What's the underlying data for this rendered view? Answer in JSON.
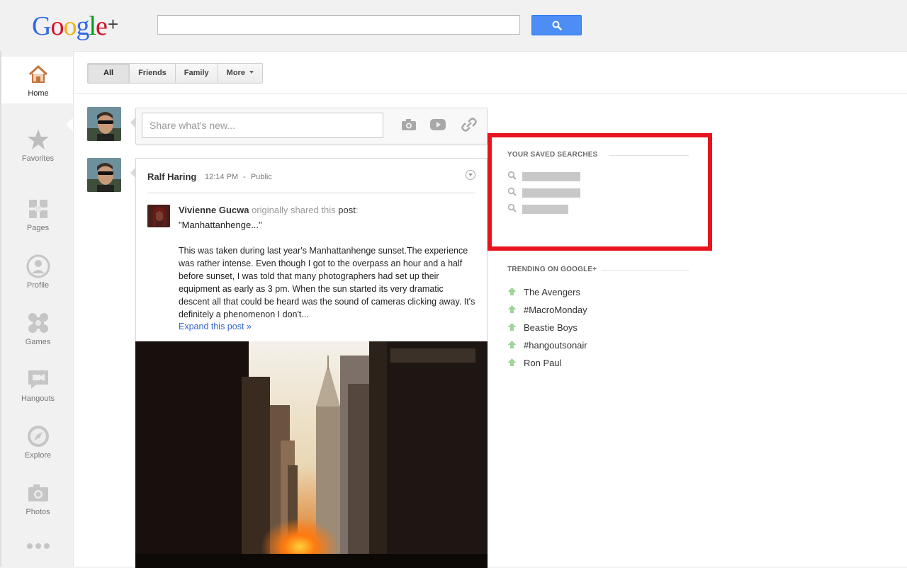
{
  "header": {
    "logo": {
      "g1": "G",
      "o1": "o",
      "o2": "o",
      "g2": "g",
      "l": "l",
      "e": "e",
      "plus": "+"
    },
    "search": {
      "value": "",
      "placeholder": ""
    }
  },
  "nav": {
    "items": [
      {
        "label": "Home",
        "icon": "home-icon"
      },
      {
        "label": "Favorites",
        "icon": "star-icon"
      },
      {
        "label": "Pages",
        "icon": "pages-icon"
      },
      {
        "label": "Profile",
        "icon": "profile-icon"
      },
      {
        "label": "Games",
        "icon": "games-icon"
      },
      {
        "label": "Hangouts",
        "icon": "hangouts-icon"
      },
      {
        "label": "Explore",
        "icon": "compass-icon"
      },
      {
        "label": "Photos",
        "icon": "camera-icon"
      }
    ],
    "more_icon": "more-dots-icon"
  },
  "filters": {
    "tabs": [
      "All",
      "Friends",
      "Family",
      "More"
    ],
    "active": "All"
  },
  "share": {
    "placeholder": "Share what's new...",
    "tools": [
      "camera-icon",
      "video-icon",
      "link-icon"
    ]
  },
  "post": {
    "author": "Ralf Haring",
    "time": "12:14 PM",
    "separator": "-",
    "visibility": "Public",
    "original_author": "Vivienne Gucwa",
    "shared_text": "originally shared this",
    "shared_object": "post",
    "shared_suffix": ":",
    "quote": "\"Manhattanhenge...\"",
    "body": "This was taken during last year's Manhattanhenge sunset.The experience was rather intense. Even though I got to the overpass an hour and a half before sunset, I was told that many photographers had set up their equipment as early as 3 pm. When the sun started its very dramatic descent all that could be heard was the sound of cameras clicking away. It's definitely a phenomenon I don't...",
    "expand_label": "Expand this post »"
  },
  "saved_searches": {
    "title": "YOUR SAVED SEARCHES",
    "count_redacted": 3
  },
  "trending": {
    "title": "TRENDING ON GOOGLE+",
    "items": [
      "The Avengers",
      "#MacroMonday",
      "Beastie Boys",
      "#hangoutsonair",
      "Ron Paul"
    ]
  },
  "colors": {
    "highlight": "#e8131f",
    "link": "#3366cc",
    "search_button": "#4c8ef5",
    "trend_arrow": "#9fd59a"
  }
}
